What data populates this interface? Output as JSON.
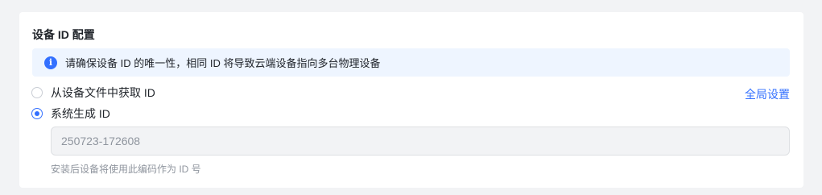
{
  "section": {
    "title": "设备 ID 配置"
  },
  "notice": {
    "icon": "info-icon",
    "icon_glyph": "i",
    "text": "请确保设备 ID 的唯一性，相同 ID 将导致云端设备指向多台物理设备"
  },
  "options": [
    {
      "label": "从设备文件中获取 ID",
      "selected": false
    },
    {
      "label": "系统生成 ID",
      "selected": true
    }
  ],
  "global_settings_link": "全局设置",
  "id_input": {
    "value": "250723-172608",
    "disabled": true
  },
  "hint": "安装后设备将使用此编码作为 ID 号",
  "colors": {
    "accent": "#3370ff",
    "notice_bg": "#eef5ff",
    "page_bg": "#f2f3f5"
  }
}
